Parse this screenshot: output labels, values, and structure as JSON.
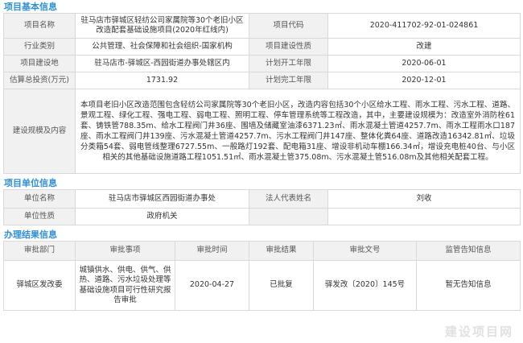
{
  "project_info": {
    "heading": "项目基本信息",
    "rows": [
      [
        "项目名称",
        "驻马店市驿城区轻纺公司家属院等30个老旧小区改造配套基础设施项目(2020年红线内)",
        "项目代码",
        "2020-411702-92-01-024861"
      ],
      [
        "行业类别",
        "公共管理、社会保障和社会组织-国家机构",
        "项目建设性质",
        "改建"
      ],
      [
        "项目建设地",
        "驻马店市-驿城区-西园街道办事处辖区内",
        "计划开工年限",
        "2020-06-01"
      ],
      [
        "估算总投资(万元)",
        "1731.92",
        "计划完工年限",
        "2020-12-01"
      ]
    ],
    "scale_label": "建设规模及内容",
    "scale_text": "本项目老旧小区改造范围包含轻纺公司家属院等30个老旧小区，改造内容包括30个小区给水工程、雨水工程、污水工程、道路、景观工程、绿化工程、强电工程、弱电工程、照明工程、停车管理系统等工程改造，其中，主要建设规模为：改造室外消防栓61套、铸铁管788.35m、给水工程阀门井36座、围墙及储藏室油漆6371.23㎡、雨水混凝土管道4257.7m、雨水工程雨水口187座、雨水工程阀门井139座、污水混凝土管道4257.7m、污水工程阀门井147座、整体化粪64座、道路改造16342.81㎡、垃圾分类箱54套、弱电管线整理6727.55m、一般路灯192套、配电箱31座、增设非机动车棚166.34㎡，增设充电桩40台、与小区相关的其他基础设施道路工程1051.51㎡、雨水混凝土管375.08m、污水混凝土管516.08m及其他相关配套工程。"
  },
  "unit_info": {
    "heading": "项目单位信息",
    "rows": [
      [
        "单位名称",
        "驻马店市驿城区西园街道办事处",
        "法人代表姓名",
        "刘收"
      ],
      [
        "单位性质",
        "政府机关",
        "",
        ""
      ]
    ]
  },
  "result_info": {
    "heading": "办理结果信息",
    "columns": [
      "审批部门",
      "审批事项",
      "审批时间",
      "审批结果",
      "审批文号",
      "监管告知信息"
    ],
    "rows": [
      [
        "驿城区发改委",
        "城镇供水、供电、供气、供热、道路、污水垃圾处理等基础设施项目可行性研究报告审批",
        "2020-04-27",
        "已批复",
        "驿发改〔2020〕145号",
        "暂无告知信息"
      ]
    ]
  },
  "watermark": "建设项目网"
}
